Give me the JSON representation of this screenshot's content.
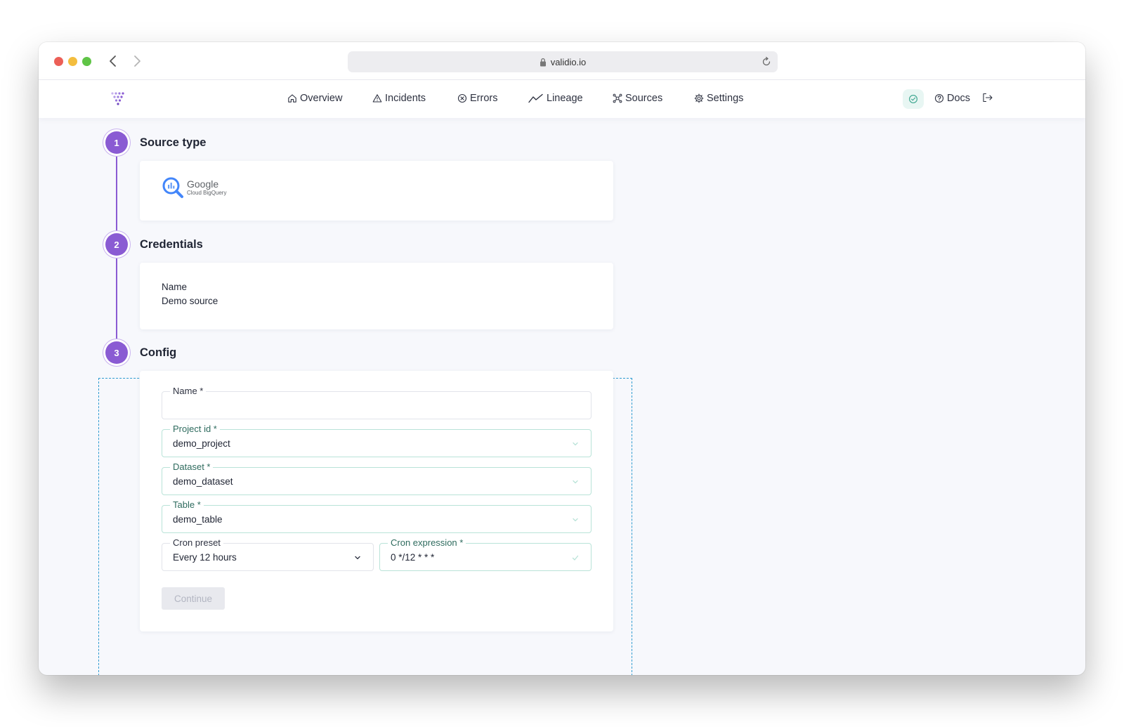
{
  "browser": {
    "url": "validio.io"
  },
  "nav": {
    "items": [
      {
        "label": "Overview",
        "icon": "home-icon"
      },
      {
        "label": "Incidents",
        "icon": "warning-icon"
      },
      {
        "label": "Errors",
        "icon": "circle-x-icon"
      },
      {
        "label": "Lineage",
        "icon": "trend-icon"
      },
      {
        "label": "Sources",
        "icon": "nodes-icon"
      },
      {
        "label": "Settings",
        "icon": "gear-icon"
      }
    ],
    "docs_label": "Docs",
    "status_icon": "check-circle-icon",
    "logout_icon": "logout-icon"
  },
  "steps": {
    "source_type": {
      "number": "1",
      "title": "Source type",
      "logo_brand": "Google",
      "logo_product": "Cloud BigQuery"
    },
    "credentials": {
      "number": "2",
      "title": "Credentials",
      "name_label": "Name",
      "name_value": "Demo source"
    },
    "config": {
      "number": "3",
      "title": "Config",
      "fields": {
        "name": {
          "label": "Name *",
          "value": ""
        },
        "project_id": {
          "label": "Project id *",
          "value": "demo_project"
        },
        "dataset": {
          "label": "Dataset *",
          "value": "demo_dataset"
        },
        "table": {
          "label": "Table *",
          "value": "demo_table"
        },
        "cron_preset": {
          "label": "Cron preset",
          "value": "Every 12 hours"
        },
        "cron_expression": {
          "label": "Cron expression *",
          "value": "0 */12 * * *"
        }
      },
      "continue_label": "Continue"
    }
  },
  "colors": {
    "accent": "#8a5bd3",
    "valid_border": "#b9e3d8",
    "focus_outline": "#2e9bd0"
  }
}
